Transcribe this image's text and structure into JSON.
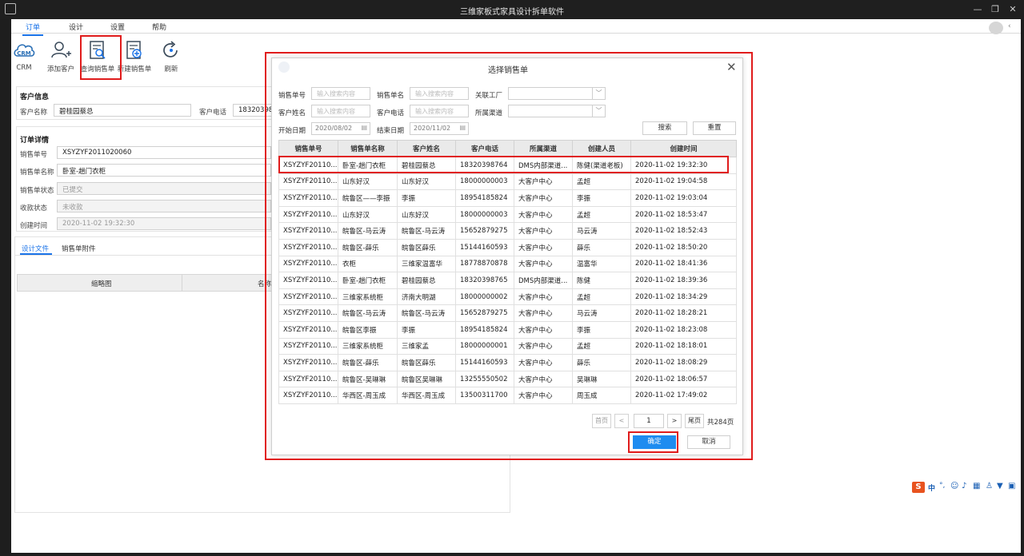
{
  "window": {
    "title": "三维家板式家具设计拆单软件"
  },
  "menu": {
    "tabs": [
      "订单",
      "设计",
      "设置",
      "帮助"
    ],
    "active": "订单"
  },
  "toolbar": {
    "crm": "CRM",
    "add_customer": "添加客户",
    "query_sales": "查询销售单",
    "new_sales": "新建销售单",
    "refresh": "刷新"
  },
  "customer_info": {
    "section": "客户信息",
    "name_label": "客户名称",
    "name_value": "碧桂园蔡总",
    "phone_label": "客户电话",
    "phone_value": "18320398"
  },
  "order_detail": {
    "section": "订单详情",
    "fields": [
      {
        "label": "销售单号",
        "value": "XSYZYF2011020060",
        "readonly": false
      },
      {
        "label": "销售单名称",
        "value": "卧室-趟门衣柜",
        "readonly": false
      },
      {
        "label": "销售单状态",
        "value": "已提交",
        "readonly": true
      },
      {
        "label": "收款状态",
        "value": "未收款",
        "readonly": true
      },
      {
        "label": "创建时间",
        "value": "2020-11-02 19:32:30",
        "readonly": true
      }
    ]
  },
  "file_tabs": [
    "设计文件",
    "销售单附件"
  ],
  "file_table": {
    "headers": [
      "缩略图",
      "名称"
    ]
  },
  "dialog": {
    "title": "选择销售单",
    "search": {
      "order_no_label": "销售单号",
      "order_no_placeholder": "输入搜索内容",
      "order_name_label": "销售单名",
      "order_name_placeholder": "输入搜索内容",
      "factory_label": "关联工厂",
      "cust_name_label": "客户姓名",
      "cust_name_placeholder": "输入搜索内容",
      "cust_phone_label": "客户电话",
      "cust_phone_placeholder": "输入搜索内容",
      "channel_label": "所属渠道",
      "start_label": "开始日期",
      "start_value": "2020/08/02",
      "end_label": "结束日期",
      "end_value": "2020/11/02",
      "search_button": "搜索",
      "reset_button": "重置"
    },
    "columns": [
      "销售单号",
      "销售单名称",
      "客户姓名",
      "客户电话",
      "所属渠道",
      "创建人员",
      "创建时间"
    ],
    "rows": [
      [
        "XSYZYF20110...",
        "卧室-趟门衣柜",
        "碧桂园蔡总",
        "18320398764",
        "DMS内部渠道...",
        "陈健(渠道老板)",
        "2020-11-02 19:32:30"
      ],
      [
        "XSYZYF20110...",
        "山东好汉",
        "山东好汉",
        "18000000003",
        "大客户中心",
        "孟超",
        "2020-11-02 19:04:58"
      ],
      [
        "XSYZYF20110...",
        "皖鲁区——李振",
        "李振",
        "18954185824",
        "大客户中心",
        "李振",
        "2020-11-02 19:03:04"
      ],
      [
        "XSYZYF20110...",
        "山东好汉",
        "山东好汉",
        "18000000003",
        "大客户中心",
        "孟超",
        "2020-11-02 18:53:47"
      ],
      [
        "XSYZYF20110...",
        "皖鲁区-马云涛",
        "皖鲁区-马云涛",
        "15652879275",
        "大客户中心",
        "马云涛",
        "2020-11-02 18:52:43"
      ],
      [
        "XSYZYF20110...",
        "皖鲁区-薛乐",
        "皖鲁区薛乐",
        "15144160593",
        "大客户中心",
        "薛乐",
        "2020-11-02 18:50:20"
      ],
      [
        "XSYZYF20110...",
        "衣柜",
        "三维家温富华",
        "18778870878",
        "大客户中心",
        "温富华",
        "2020-11-02 18:41:36"
      ],
      [
        "XSYZYF20110...",
        "卧室-趟门衣柜",
        "碧桂园蔡总",
        "18320398765",
        "DMS内部渠道...",
        "陈健",
        "2020-11-02 18:39:36"
      ],
      [
        "XSYZYF20110...",
        "三维家系统柜",
        "济南大明湖",
        "18000000002",
        "大客户中心",
        "孟超",
        "2020-11-02 18:34:29"
      ],
      [
        "XSYZYF20110...",
        "皖鲁区-马云涛",
        "皖鲁区-马云涛",
        "15652879275",
        "大客户中心",
        "马云涛",
        "2020-11-02 18:28:21"
      ],
      [
        "XSYZYF20110...",
        "皖鲁区李振",
        "李振",
        "18954185824",
        "大客户中心",
        "李振",
        "2020-11-02 18:23:08"
      ],
      [
        "XSYZYF20110...",
        "三维家系统柜",
        "三维家孟",
        "18000000001",
        "大客户中心",
        "孟超",
        "2020-11-02 18:18:01"
      ],
      [
        "XSYZYF20110...",
        "皖鲁区-薛乐",
        "皖鲁区薛乐",
        "15144160593",
        "大客户中心",
        "薛乐",
        "2020-11-02 18:08:29"
      ],
      [
        "XSYZYF20110...",
        "皖鲁区-吴琳琳",
        "皖鲁区吴琳琳",
        "13255550502",
        "大客户中心",
        "吴琳琳",
        "2020-11-02 18:06:57"
      ],
      [
        "XSYZYF20110...",
        "华西区-周玉成",
        "华西区-周玉成",
        "13500311700",
        "大客户中心",
        "周玉成",
        "2020-11-02 17:49:02"
      ]
    ],
    "pager": {
      "first": "首页",
      "prev": "<",
      "page": "1",
      "next": ">",
      "last": "尾页",
      "total": "共284页"
    },
    "ok_button": "确定",
    "cancel_button": "取消"
  },
  "ime": {
    "label": "中"
  },
  "colors": {
    "accent": "#1a73e8",
    "highlight": "#e01c1c",
    "primary_button": "#1e8cf0"
  }
}
